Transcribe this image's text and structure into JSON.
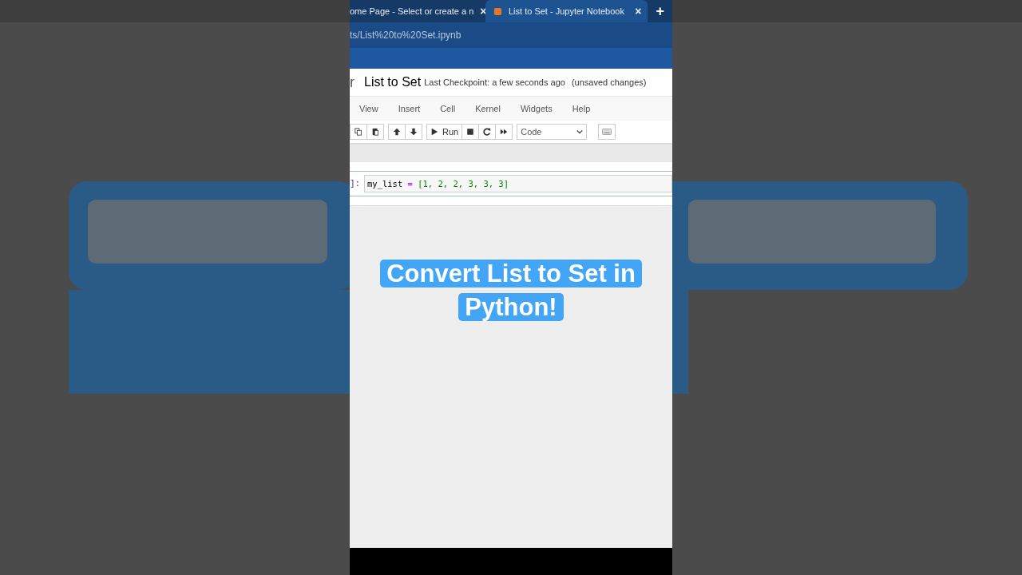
{
  "browser": {
    "tabs": [
      {
        "label": "ome Page - Select or create a n",
        "close": "×",
        "selected": false,
        "icon": false
      },
      {
        "label": "List to Set - Jupyter Notebook",
        "close": "×",
        "selected": true,
        "icon": true
      }
    ],
    "new_tab": "+",
    "url": "ts/List%20to%20Set.ipynb"
  },
  "header": {
    "logo": "r",
    "title": "List to Set",
    "checkpoint": "Last Checkpoint: a few seconds ago",
    "status": "(unsaved changes)"
  },
  "menu": [
    "View",
    "Insert",
    "Cell",
    "Kernel",
    "Widgets",
    "Help"
  ],
  "toolbar": [
    [
      {
        "kind": "copy"
      },
      {
        "kind": "paste"
      }
    ],
    [
      {
        "kind": "up"
      },
      {
        "kind": "down"
      }
    ],
    [
      {
        "kind": "run",
        "label": "Run"
      },
      {
        "kind": "stop"
      },
      {
        "kind": "restart"
      },
      {
        "kind": "fastforward"
      }
    ]
  ],
  "cell_type": "Code",
  "cell": {
    "prompt": "]:",
    "code": [
      {
        "kind": "name",
        "text": "my_list "
      },
      {
        "kind": "op",
        "text": "="
      },
      {
        "kind": "num",
        "text": " [1, 2, 2, 3, 3, 3]"
      }
    ]
  },
  "caption": "Convert List to Set in Python!"
}
